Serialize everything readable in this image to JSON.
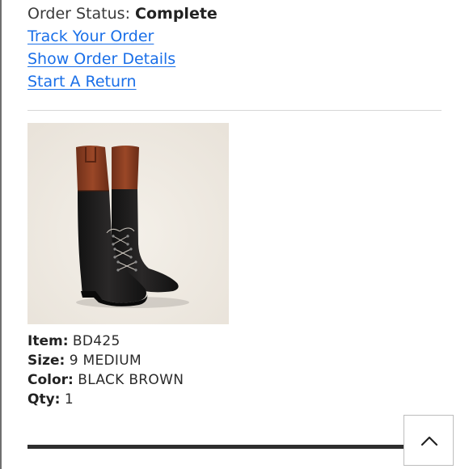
{
  "order": {
    "status_label": "Order Status:",
    "status_value": "Complete",
    "links": {
      "track": "Track Your Order",
      "details": "Show Order Details",
      "return": "Start A Return"
    }
  },
  "item": {
    "image_subject": "tall black and cognac brown lace-up riding boots",
    "item_label": "Item:",
    "item_value": "BD425",
    "size_label": "Size:",
    "size_value": "9 MEDIUM",
    "color_label": "Color:",
    "color_value": "BLACK BROWN",
    "qty_label": "Qty:",
    "qty_value": "1"
  },
  "controls": {
    "scroll_top_icon": "chevron-up-icon"
  },
  "colors": {
    "link": "#1a6fe8",
    "image_background": "#efeae2",
    "boot_black": "#1d1c1c",
    "boot_brown": "#8a3e22"
  }
}
